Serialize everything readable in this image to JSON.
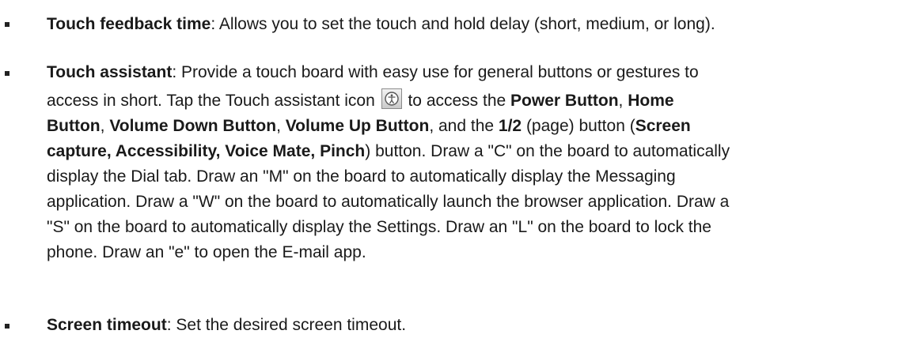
{
  "items": [
    {
      "term": "Touch feedback time",
      "text": ": Allows you to set the touch and hold delay (short, medium, or long)."
    },
    {
      "term": "Touch assistant",
      "line1": ": Provide a touch board with easy use for general buttons or gestures to",
      "line2_pre": "access in short. Tap the Touch assistant icon ",
      "icon": "touch-assistant-icon",
      "line2_post": " to access the ",
      "power": "Power Button",
      "comma1": ", ",
      "home": "Home",
      "button_word": "Button",
      "comma2": ", ",
      "vol_down": "Volume Down Button",
      "comma3": ", ",
      "vol_up": "Volume Up Button",
      "and_the": ", and the ",
      "half": "1/2",
      "page_paren": " (page) button (",
      "screen": "Screen",
      "capture_list": "capture, Accessibility, Voice Mate, Pinch",
      "line4_post": ") button. Draw a \"C\" on the board to automatically",
      "line5": "display the Dial tab. Draw an \"M\" on the board to automatically display the Messaging",
      "line6": "application. Draw a \"W\" on the board to automatically launch the browser application. Draw a",
      "line7": "\"S\" on the board to automatically display the Settings. Draw an \"L\" on the board to lock the",
      "line8": "phone. Draw an \"e\" to open the E-mail app."
    },
    {
      "term": "Screen timeout",
      "text": ": Set the desired screen timeout."
    }
  ]
}
